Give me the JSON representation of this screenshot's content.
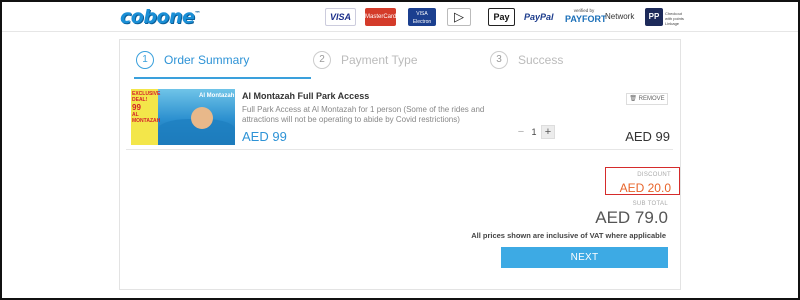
{
  "header": {
    "logo_text": "cobone",
    "payment_methods": {
      "visa": "VISA",
      "mastercard": "MasterCard",
      "visa_electron": "VISA Electron",
      "arrow": "▷",
      "apple_pay": "Pay",
      "paypal": "PayPal",
      "payfort_verified": "verified by",
      "payfort": "PAYFORT",
      "network": "Network",
      "pp": "PP",
      "checkout": "Checkout with points Linkage"
    }
  },
  "steps": [
    {
      "num": "1",
      "label": "Order Summary",
      "active": true
    },
    {
      "num": "2",
      "label": "Payment Type",
      "active": false
    },
    {
      "num": "3",
      "label": "Success",
      "active": false
    }
  ],
  "item": {
    "title": "Al Montazah Full Park Access",
    "description": "Full Park Access at Al Montazah for 1 person (Some of the rides and attractions will not be operating to abide by Covid restrictions)",
    "price": "AED 99",
    "remove_label": "REMOVE",
    "quantity": "1",
    "qty_minus": "−",
    "qty_plus": "+",
    "total": "AED 99",
    "thumb": {
      "badge_line1": "EXCLUSIVE DEAL!",
      "badge_price": "99",
      "badge_line2": "AL MONTAZAH",
      "logo": "Al Montazah"
    }
  },
  "summary": {
    "discount_label": "DISCOUNT",
    "discount_value": "AED 20.0",
    "subtotal_label": "SUB TOTAL",
    "subtotal_value": "AED 79.0",
    "vat_note": "All prices shown are inclusive of VAT where applicable",
    "next_label": "NEXT"
  },
  "colors": {
    "accent": "#3aa0dc",
    "discount": "#e8642a",
    "highlight_border": "#d52b2b",
    "next_button": "#3daae4"
  }
}
